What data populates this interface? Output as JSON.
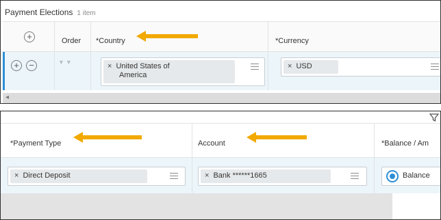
{
  "payment_elections": {
    "title": "Payment Elections",
    "count": "1 item",
    "headers": {
      "order": "Order",
      "country": "*Country",
      "currency": "*Currency"
    },
    "row": {
      "country_line1": "United States of",
      "country_line2": "America",
      "currency": "USD"
    }
  },
  "payment_details": {
    "headers": {
      "payment_type": "*Payment Type",
      "account": "Account",
      "balance": "*Balance / Am"
    },
    "row": {
      "payment_type": "Direct Deposit",
      "account": "Bank ******1665",
      "balance": "Balance"
    }
  },
  "glyphs": {
    "remove": "×",
    "add": "+",
    "minus": "−",
    "sort": "▼▼",
    "scroll_left": "◂"
  },
  "colors": {
    "arrow": "#f2a900",
    "accent": "#2c8ed6",
    "row_highlight": "#ecf5fa"
  }
}
